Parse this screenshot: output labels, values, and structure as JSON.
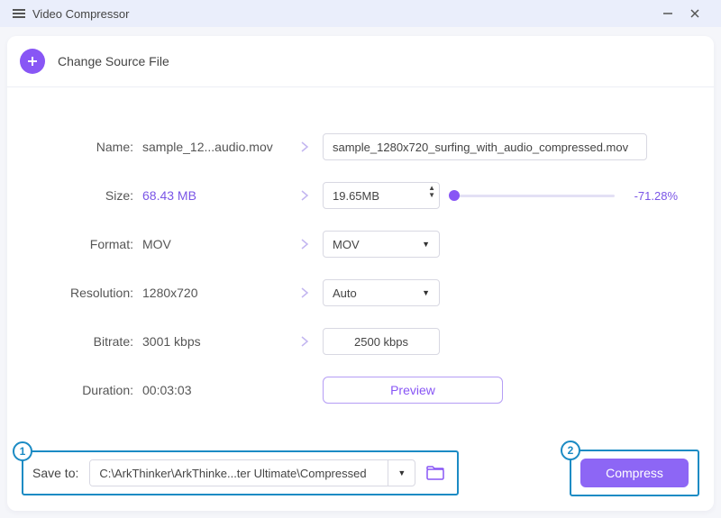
{
  "title": "Video Compressor",
  "sourceRow": {
    "label": "Change Source File"
  },
  "labels": {
    "name": "Name:",
    "size": "Size:",
    "format": "Format:",
    "resolution": "Resolution:",
    "bitrate": "Bitrate:",
    "duration": "Duration:",
    "saveTo": "Save to:"
  },
  "original": {
    "name": "sample_12...audio.mov",
    "size": "68.43 MB",
    "format": "MOV",
    "resolution": "1280x720",
    "bitrate": "3001 kbps",
    "duration": "00:03:03"
  },
  "target": {
    "name": "sample_1280x720_surfing_with_audio_compressed.mov",
    "size": "19.65MB",
    "sizePct": "-71.28%",
    "format": "MOV",
    "resolution": "Auto",
    "bitrate": "2500 kbps"
  },
  "buttons": {
    "preview": "Preview",
    "compress": "Compress"
  },
  "savePath": "C:\\ArkThinker\\ArkThinke...ter Ultimate\\Compressed",
  "callouts": {
    "one": "1",
    "two": "2"
  }
}
